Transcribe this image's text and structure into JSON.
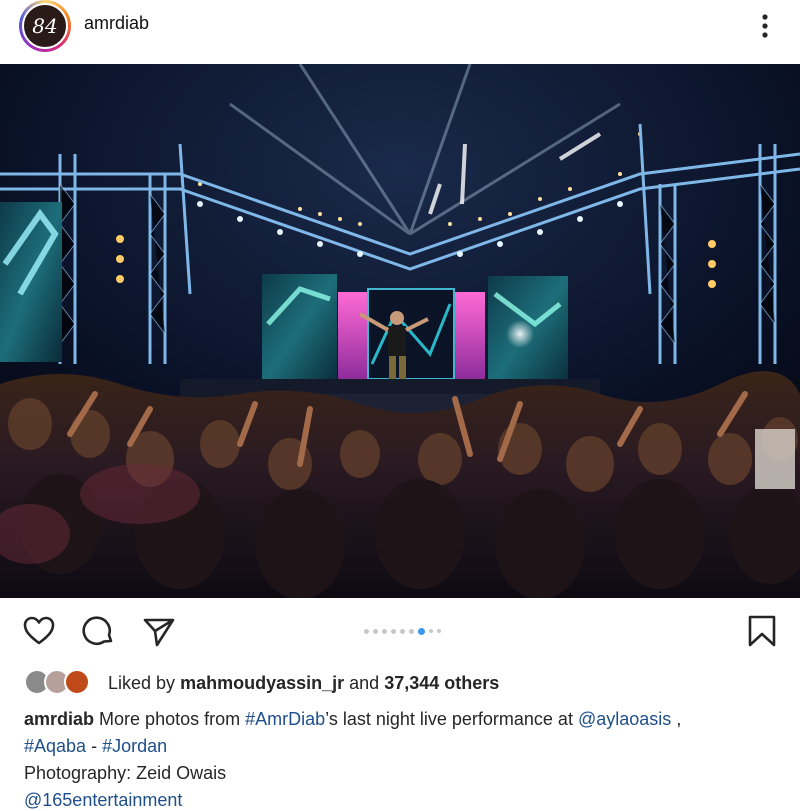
{
  "header": {
    "avatar_text": "84",
    "username": "amrdiab"
  },
  "carousel": {
    "total": 9,
    "active_index": 6
  },
  "likes": {
    "prefix": "Liked by",
    "user": "mahmoudyassin_jr",
    "middle": "and",
    "count": "37,344 others"
  },
  "caption": {
    "username": "amrdiab",
    "text_1": "More photos from",
    "hashtag_1": "#AmrDiab",
    "text_2": "’s last night live performance at",
    "mention_1": "@aylaoasis",
    "text_3": ",",
    "hashtag_2": "#Aqaba",
    "text_4": "-",
    "hashtag_3": "#Jordan",
    "line_3": "Photography: Zeid Owais",
    "mention_2": "@165entertainment"
  },
  "colors": {
    "link": "#1f4f8a",
    "active_dot": "#3897f0",
    "inactive_dot": "#c7c7c7"
  },
  "icons": [
    "more-vertical-icon",
    "heart-icon",
    "comment-icon",
    "share-icon",
    "bookmark-icon"
  ]
}
